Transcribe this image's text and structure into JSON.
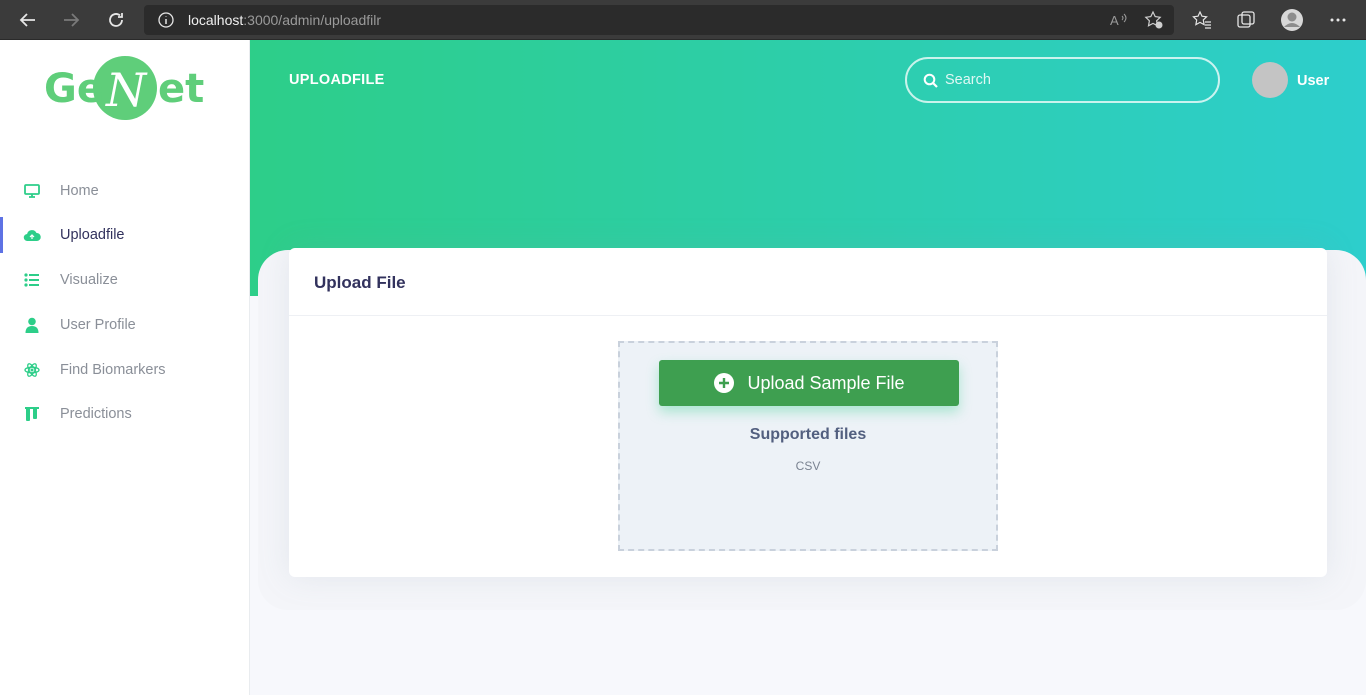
{
  "browser": {
    "url_host": "localhost",
    "url_rest": ":3000/admin/uploadfilr"
  },
  "sidebar": {
    "items": [
      {
        "label": "Home",
        "icon": "monitor-icon"
      },
      {
        "label": "Uploadfile",
        "icon": "cloud-upload-icon"
      },
      {
        "label": "Visualize",
        "icon": "list-icon"
      },
      {
        "label": "User Profile",
        "icon": "user-icon"
      },
      {
        "label": "Find Biomarkers",
        "icon": "atom-icon"
      },
      {
        "label": "Predictions",
        "icon": "test-tubes-icon"
      }
    ]
  },
  "header": {
    "title": "UPLOADFILE",
    "search_placeholder": "Search",
    "user_name": "User"
  },
  "card": {
    "title": "Upload File",
    "upload_button_label": "Upload Sample File",
    "supported_title": "Supported files",
    "supported_types": "CSV"
  },
  "colors": {
    "accent_green": "#2dce89",
    "accent_teal": "#2dcecc",
    "button_green": "#3e9f50",
    "active_indicator": "#5e72e4"
  }
}
